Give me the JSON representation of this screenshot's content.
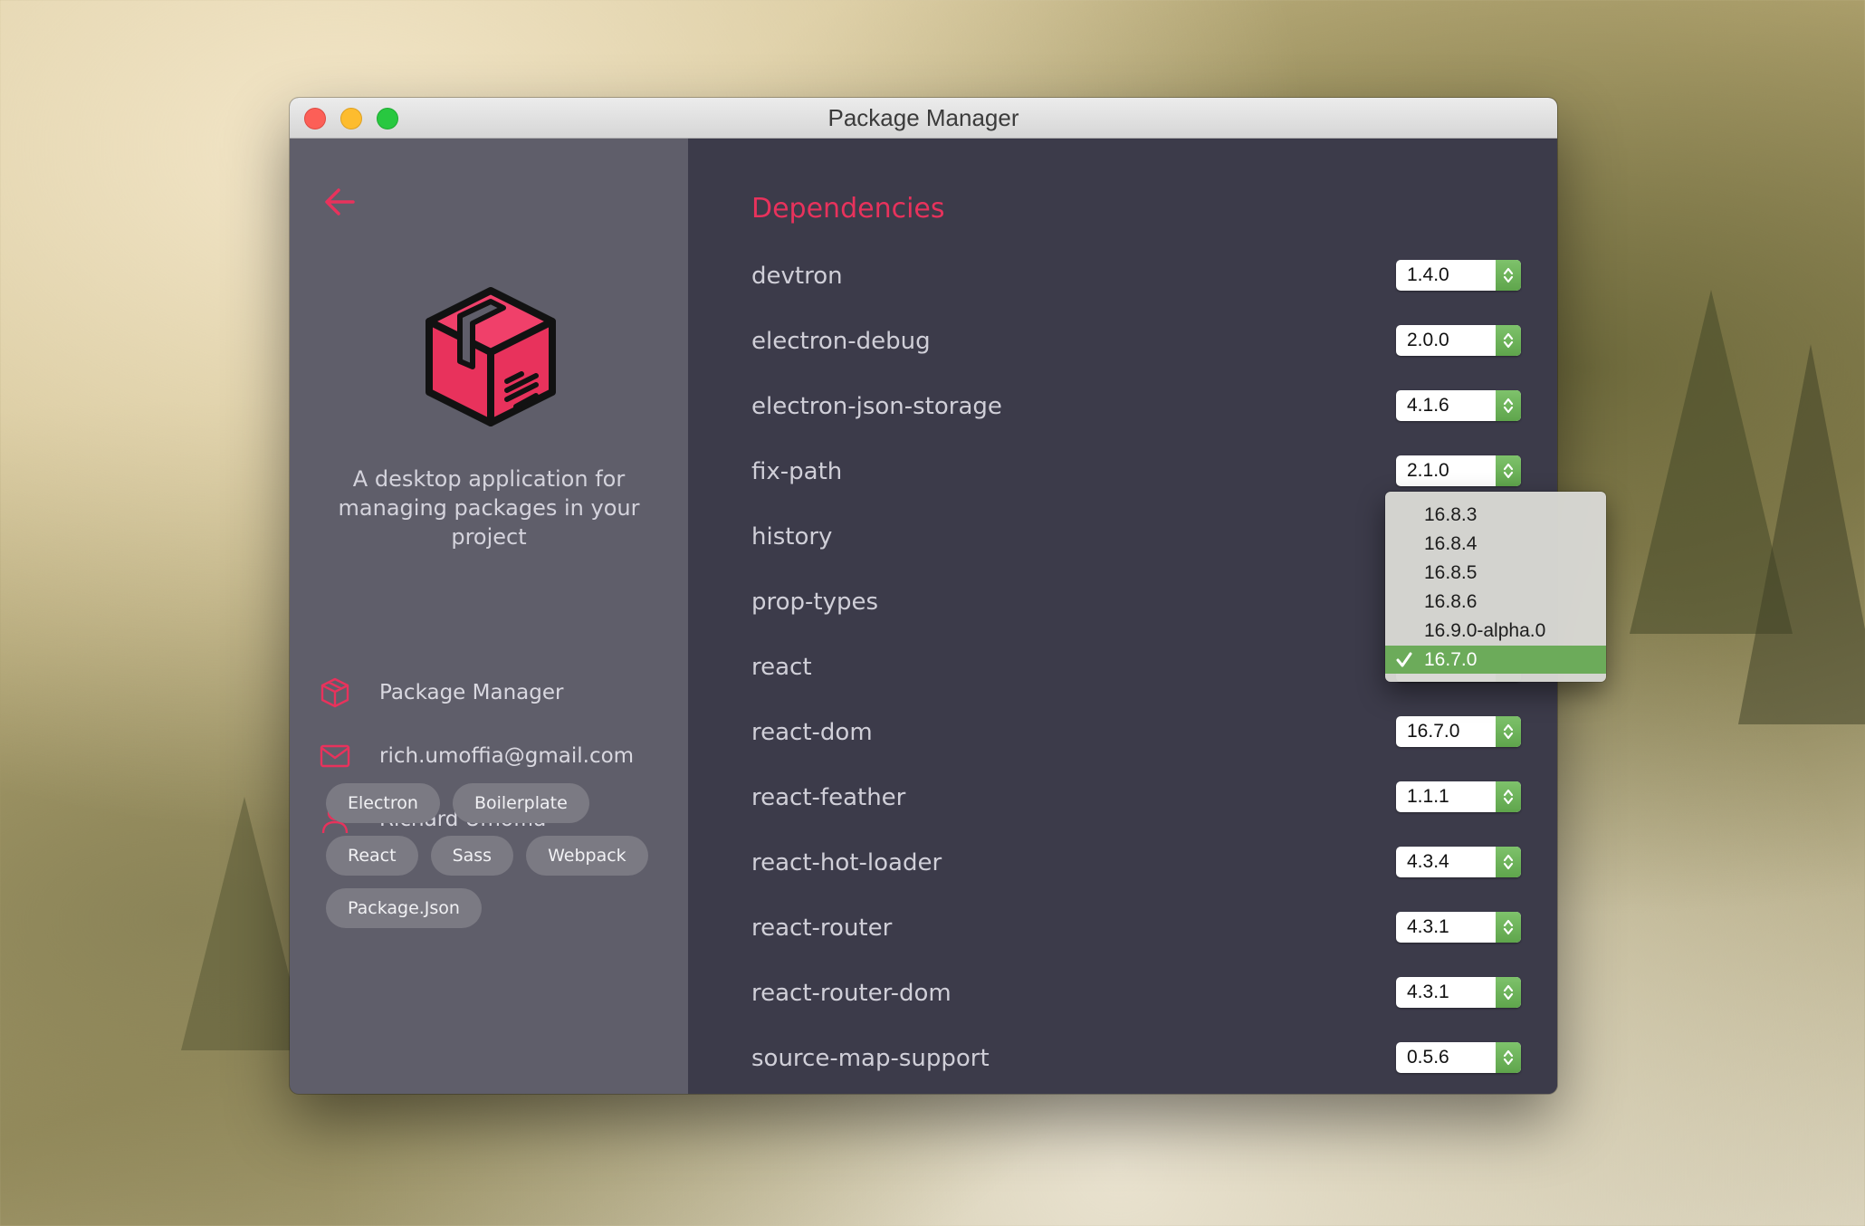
{
  "window": {
    "title": "Package Manager"
  },
  "sidebar": {
    "description": "A desktop application for managing packages in your project",
    "info": [
      {
        "icon": "package-icon",
        "text": "Package Manager"
      },
      {
        "icon": "mail-icon",
        "text": "rich.umoffia@gmail.com"
      },
      {
        "icon": "user-icon",
        "text": "Richard Umoffia"
      }
    ],
    "tags": [
      "Electron",
      "Boilerplate",
      "React",
      "Sass",
      "Webpack",
      "Package.Json"
    ]
  },
  "main": {
    "heading": "Dependencies",
    "dependencies": [
      {
        "name": "devtron",
        "version": "1.4.0"
      },
      {
        "name": "electron-debug",
        "version": "2.0.0"
      },
      {
        "name": "electron-json-storage",
        "version": "4.1.6"
      },
      {
        "name": "fix-path",
        "version": "2.1.0"
      },
      {
        "name": "history",
        "version": ""
      },
      {
        "name": "prop-types",
        "version": ""
      },
      {
        "name": "react",
        "version": "16.7.0"
      },
      {
        "name": "react-dom",
        "version": "16.7.0"
      },
      {
        "name": "react-feather",
        "version": "1.1.1"
      },
      {
        "name": "react-hot-loader",
        "version": "4.3.4"
      },
      {
        "name": "react-router",
        "version": "4.3.1"
      },
      {
        "name": "react-router-dom",
        "version": "4.3.1"
      },
      {
        "name": "source-map-support",
        "version": "0.5.6"
      }
    ]
  },
  "version_dropdown": {
    "options": [
      "16.8.3",
      "16.8.4",
      "16.8.5",
      "16.8.6",
      "16.9.0-alpha.0",
      "16.7.0"
    ],
    "selected": "16.7.0"
  },
  "colors": {
    "accent": "#e8325c",
    "sidebar_bg": "#5f5e6a",
    "main_bg": "#3c3b4a",
    "select_arrow_green": "#6cab5a",
    "tag_bg": "#7b7a83"
  }
}
